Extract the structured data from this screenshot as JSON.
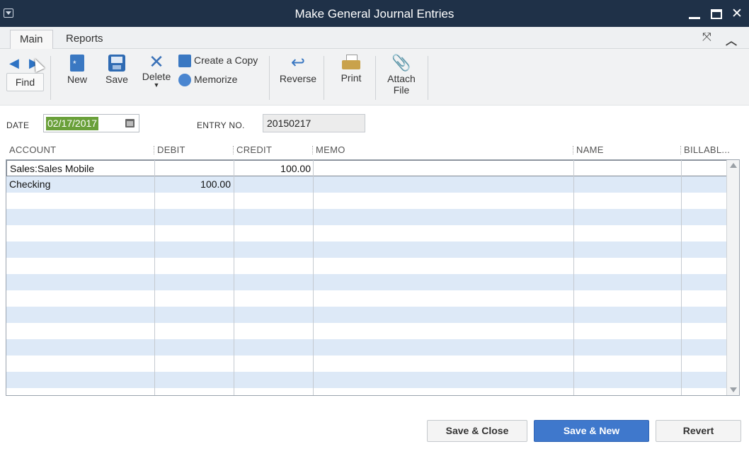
{
  "window": {
    "title": "Make General Journal Entries"
  },
  "tabs": [
    {
      "label": "Main",
      "active": true
    },
    {
      "label": "Reports",
      "active": false
    }
  ],
  "toolbar": {
    "find_label": "Find",
    "new_label": "New",
    "save_label": "Save",
    "delete_label": "Delete",
    "create_copy_label": "Create a Copy",
    "memorize_label": "Memorize",
    "reverse_label": "Reverse",
    "print_label": "Print",
    "attach_label_1": "Attach",
    "attach_label_2": "File"
  },
  "form": {
    "date_label": "DATE",
    "date_value": "02/17/2017",
    "entry_label": "ENTRY NO.",
    "entry_value": "20150217"
  },
  "grid": {
    "columns": [
      "ACCOUNT",
      "DEBIT",
      "CREDIT",
      "MEMO",
      "NAME",
      "BILLABL..."
    ],
    "rows": [
      {
        "account": "Sales:Sales Mobile",
        "debit": "",
        "credit": "100.00",
        "memo": "",
        "name": ""
      },
      {
        "account": "Checking",
        "debit": "100.00",
        "credit": "",
        "memo": "",
        "name": ""
      }
    ]
  },
  "footer": {
    "save_close_label": "Save & Close",
    "save_new_label": "Save & New",
    "revert_label": "Revert"
  },
  "colors": {
    "titlebar": "#1f3148",
    "accent_button": "#3f78cc",
    "row_alt": "#dde9f7",
    "date_highlight": "#6aa03a"
  },
  "icons": [
    "back-arrow-icon",
    "forward-arrow-icon",
    "new-document-icon",
    "save-disk-icon",
    "delete-x-icon",
    "create-copy-icon",
    "memorize-icon",
    "reverse-arrow-icon",
    "printer-icon",
    "paperclip-icon",
    "calendar-icon",
    "expand-icon",
    "collapse-chevron-icon",
    "minimize-icon",
    "maximize-icon",
    "close-icon"
  ]
}
